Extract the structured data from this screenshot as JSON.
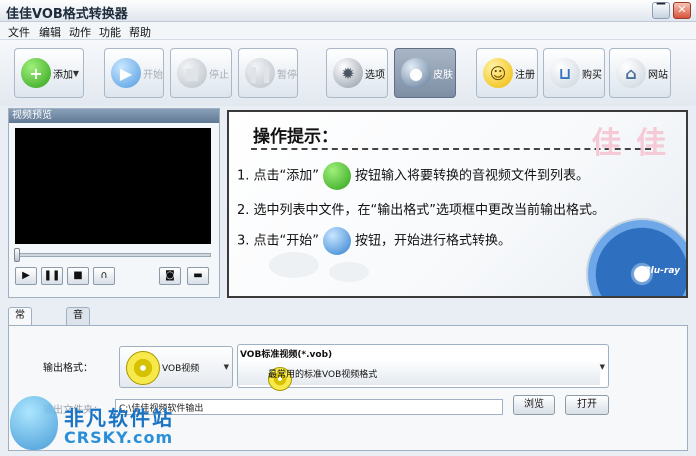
{
  "window": {
    "title": "佳佳VOB格式转换器",
    "min": "▔",
    "close": "✕"
  },
  "menu": [
    "文件",
    "编辑",
    "动作",
    "功能",
    "帮助"
  ],
  "toolbar": {
    "add": "添加",
    "start": "开始",
    "stop": "停止",
    "pause": "暂停",
    "options": "选项",
    "skin": "皮肤",
    "register": "注册",
    "buy": "购买",
    "website": "网站"
  },
  "preview": {
    "title": "视频预览",
    "buttons": {
      "play": "▶",
      "pause": "❚❚",
      "stop": "■",
      "volume": "∩",
      "snapshot": "◙",
      "folder": "▬"
    }
  },
  "tips": {
    "title": "操作提示：",
    "brand": "佳 佳",
    "step1_a": "1. 点击“添加”",
    "step1_b": "按钮输入将要转换的音视频文件到列表。",
    "step2": "2. 选中列表中文件，在“输出格式”选项框中更改当前输出格式。",
    "step3_a": "3. 点击“开始”",
    "step3_b": "按钮，开始进行格式转换。",
    "disc_brand": "Blu-ray"
  },
  "settings": {
    "tabs": [
      "常规设置",
      "音视频高级设置"
    ],
    "output_format_label": "输出格式：",
    "format_name": "VOB视频",
    "format_title": "VOB标准视频(*.vob)",
    "format_desc": "最常用的标准VOB视频格式",
    "output_folder_label": "输出文件夹：",
    "output_path": "C:\\佳佳视频软件输出",
    "browse": "浏览",
    "open": "打开"
  },
  "watermark": {
    "cn": "非凡软件站",
    "en": "CRSKY.com"
  }
}
